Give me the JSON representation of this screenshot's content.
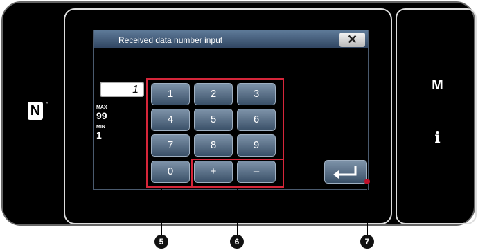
{
  "side_menu": {
    "m_label": "M",
    "info_label": "i"
  },
  "nfc": {
    "glyph": "N",
    "trademark": "™"
  },
  "dialog": {
    "title": "Received data number input",
    "close_label": "✕",
    "current_value": "1",
    "max_label": "MAX",
    "max_value": "99",
    "min_label": "MIN",
    "min_value": "1"
  },
  "keypad": {
    "k1": "1",
    "k2": "2",
    "k3": "3",
    "k4": "4",
    "k5": "5",
    "k6": "6",
    "k7": "7",
    "k8": "8",
    "k9": "9",
    "k0": "0",
    "plus": "+",
    "minus": "–"
  },
  "enter_icon": "enter-icon",
  "callouts": {
    "c5": "5",
    "c6": "6",
    "c7": "7"
  },
  "colors": {
    "highlight": "#d6263a",
    "key_top": "#7e93a9",
    "key_bottom": "#3a5068",
    "titlebar": "#4a6584"
  }
}
